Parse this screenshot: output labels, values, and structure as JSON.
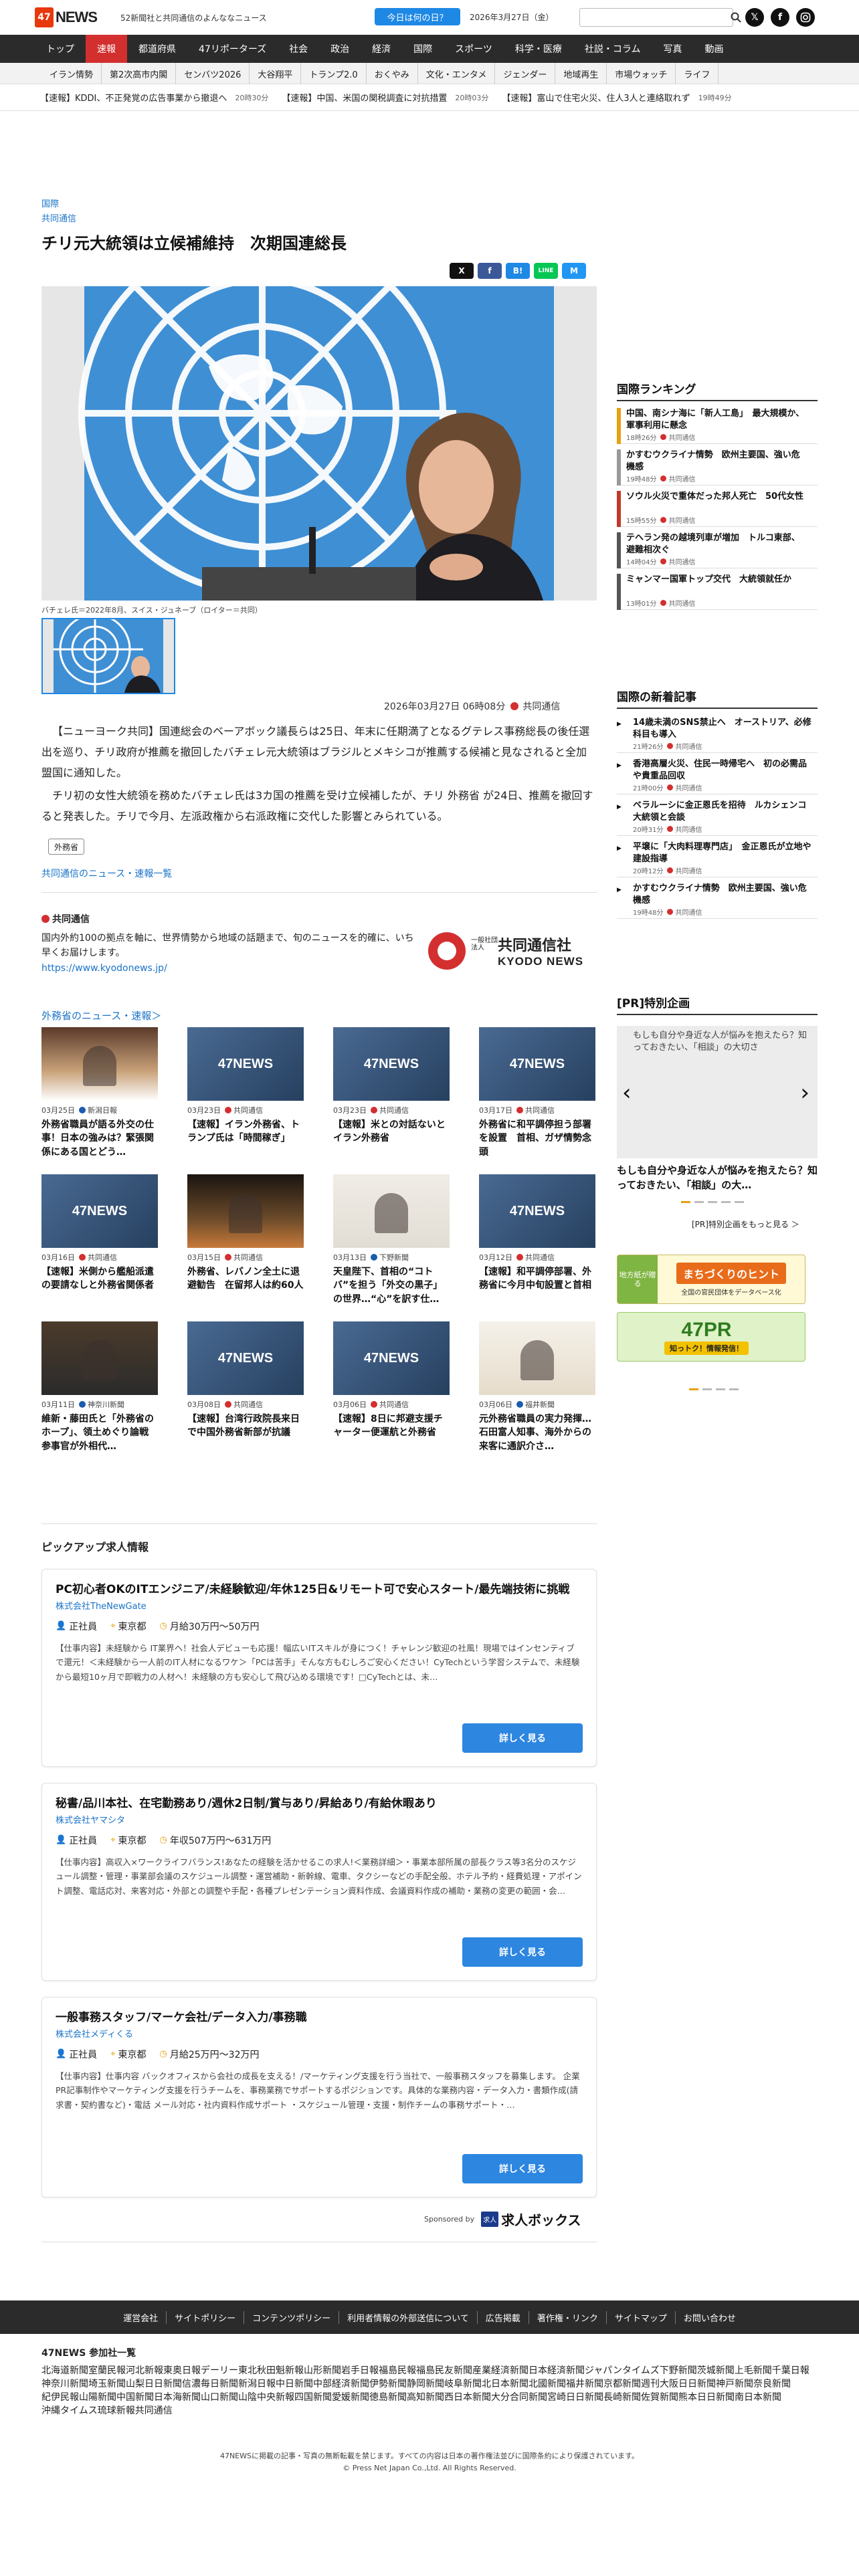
{
  "header": {
    "logo_mark": "47",
    "logo_text": "NEWS",
    "tagline": "52新聞社と共同通信のよんななニュース",
    "today_button": "今日は何の日？",
    "date": "2026年3月27日（金）",
    "search_placeholder": ""
  },
  "main_nav": [
    "トップ",
    "速報",
    "都道府県",
    "47リポーターズ",
    "社会",
    "政治",
    "経済",
    "国際",
    "スポーツ",
    "科学・医療",
    "社説・コラム",
    "写真",
    "動画"
  ],
  "main_nav_active": "速報",
  "sub_nav": [
    "イラン情勢",
    "第2次高市内閣",
    "センバツ2026",
    "大谷翔平",
    "トランプ2.0",
    "おくやみ",
    "文化・エンタメ",
    "ジェンダー",
    "地域再生",
    "市場ウォッチ",
    "ライフ"
  ],
  "ticker": [
    {
      "text": "【速報】KDDI、不正発覚の広告事業から撤退へ",
      "time": "20時30分"
    },
    {
      "text": "【速報】中国、米国の関税調査に対抗措置",
      "time": "20時03分"
    },
    {
      "text": "【速報】富山で住宅火災、住人3人と連絡取れず",
      "time": "19時49分"
    }
  ],
  "article": {
    "category": "国際",
    "source": "共同通信",
    "title": "チリ元大統領は立候補維持　次期国連総長",
    "caption": "バチェレ氏＝2022年8月、スイス・ジュネーブ（ロイター＝共同）",
    "pub_date": "2026年03月27日 06時08分",
    "pub_source": "共同通信",
    "paragraphs": [
      "【ニューヨーク共同】国連総会のベーアボック議長らは25日、年末に任期満了となるグテレス事務総長の後任選出を巡り、チリ政府が推薦を撤回したバチェレ元大統領はブラジルとメキシコが推薦する候補と見なされると全加盟国に通知した。",
      "チリ初の女性大統領を務めたバチェレ氏は3カ国の推薦を受け立候補したが、チリ 外務省 が24日、推薦を撤回すると発表した。チリで今月、左派政権から右派政権に交代した影響とみられている。"
    ],
    "tag": "外務省",
    "more_link": "共同通信のニュース・速報一覧",
    "share": [
      "X",
      "f",
      "B!",
      "LINE",
      "M"
    ]
  },
  "kyodo": {
    "name": "共同通信",
    "desc": "国内外約100の拠点を軸に、世界情勢から地域の話題まで、旬のニュースを的確に、いち早くお届けします。",
    "url": "https://www.kyodonews.jp/",
    "logo_small": "一般社団法人",
    "logo_jp": "共同通信社",
    "logo_en": "KYODO NEWS"
  },
  "related": {
    "heading": "外務省のニュース・速報＞",
    "items": [
      {
        "date": "03月25日",
        "source": "新潟日報",
        "title": "外務省職員が語る外交の仕事！日本の強みは？緊張関係にある国とどう…",
        "img": "photo-room"
      },
      {
        "date": "03月23日",
        "source": "共同通信",
        "title": "【速報】イラン外務省、トランプ氏は「時間稼ぎ」",
        "img": "47news"
      },
      {
        "date": "03月23日",
        "source": "共同通信",
        "title": "【速報】米との対話ないとイラン外務省",
        "img": "47news"
      },
      {
        "date": "03月17日",
        "source": "共同通信",
        "title": "外務省に和平調停担う部署を設置　首相、ガザ情勢念頭",
        "img": "47news"
      },
      {
        "date": "03月16日",
        "source": "共同通信",
        "title": "【速報】米側から艦船派遣の要請なしと外務省関係者",
        "img": "47news"
      },
      {
        "date": "03月15日",
        "source": "共同通信",
        "title": "外務省、レバノン全土に退避勧告　在留邦人は約60人",
        "img": "photo-fire"
      },
      {
        "date": "03月13日",
        "source": "下野新聞",
        "title": "天皇陛下、首相の“コトバ”を担う「外交の黒子」の世界…“心”を訳す仕…",
        "img": "photo-group"
      },
      {
        "date": "03月12日",
        "source": "共同通信",
        "title": "【速報】和平調停部署、外務省に今月中旬設置と首相",
        "img": "47news"
      },
      {
        "date": "03月11日",
        "source": "神奈川新聞",
        "title": "維新・藤田氏と「外務省のホープ」、領土めぐり論戦　参事官が外相代…",
        "img": "photo-man"
      },
      {
        "date": "03月08日",
        "source": "共同通信",
        "title": "【速報】台湾行政院長来日で中国外務省新部が抗議",
        "img": "47news"
      },
      {
        "date": "03月06日",
        "source": "共同通信",
        "title": "【速報】8日に邦避支援チャーター便運航と外務省",
        "img": "47news"
      },
      {
        "date": "03月06日",
        "source": "福井新聞",
        "title": "元外務省職員の実力発揮…石田富人知事、海外からの来客に通訳介さ…",
        "img": "photo-meet"
      }
    ]
  },
  "ranking": {
    "heading": "国際ランキング",
    "items": [
      {
        "rank": "1",
        "title": "中国、南シナ海に「新人工島」　最大規模か、軍事利用に懸念",
        "time": "18時26分",
        "source": "共同通信"
      },
      {
        "rank": "2",
        "title": "かすむウクライナ情勢　欧州主要国、強い危機感",
        "time": "19時48分",
        "source": "共同通信"
      },
      {
        "rank": "3",
        "title": "ソウル火災で重体だった邦人死亡　50代女性",
        "time": "15時55分",
        "source": "共同通信"
      },
      {
        "rank": "4",
        "title": "テヘラン発の越境列車が増加　トルコ東部、避難相次ぐ",
        "time": "14時04分",
        "source": "共同通信"
      },
      {
        "rank": "5",
        "title": "ミャンマー国軍トップ交代　大統領就任か",
        "time": "13時01分",
        "source": "共同通信"
      }
    ]
  },
  "newest": {
    "heading": "国際の新着記事",
    "items": [
      {
        "title": "14歳未満のSNS禁止へ　オーストリア、必修科目も導入",
        "time": "21時26分",
        "source": "共同通信"
      },
      {
        "title": "香港高層火災、住民一時帰宅へ　初の必需品や貴重品回収",
        "time": "21時00分",
        "source": "共同通信"
      },
      {
        "title": "ベラルーシに金正恩氏を招待　ルカシェンコ大統領と会談",
        "time": "20時31分",
        "source": "共同通信"
      },
      {
        "title": "平壌に「大肉料理専門店」　金正恩氏が立地や建設指導",
        "time": "20時12分",
        "source": "共同通信"
      },
      {
        "title": "かすむウクライナ情勢　欧州主要国、強い危機感",
        "time": "19時48分",
        "source": "共同通信"
      }
    ]
  },
  "pr": {
    "heading": "[PR]特別企画",
    "slide_alt": "もしも自分や身近な人が悩みを抱えたら？知っておきたい、「相談」の大切さ",
    "title": "もしも自分や身近な人が悩みを抱えたら？知っておきたい、「相談」の大…",
    "more": "[PR]特別企画をもっと見る ＞",
    "banner1_small": "地方紙が贈る",
    "banner1_big": "まちづくりのヒント",
    "banner1_sub": "全国の官民団体をデータベース化",
    "banner2_big": "47PR",
    "banner2_sub": "知っトク！情報発信！"
  },
  "jobs": {
    "heading": "ピックアップ求人情報",
    "items": [
      {
        "title": "PC初心者OKのITエンジニア/未経験歓迎/年休125日&リモート可で安心スタート/最先端技術に挑戦",
        "company": "株式会社TheNewGate",
        "type": "正社員",
        "place": "東京都",
        "salary": "月給30万円〜50万円",
        "desc": "【仕事内容】未経験から IT業界へ！社会人デビューも応援！幅広いITスキルが身につく！チャレンジ歓迎の社風！現場ではインセンティブで還元！＜未経験から一人前のIT人材になるワケ＞「PCは苦手」そんな方もむしろご安心ください！CyTechという学習システムで、未経験から最短10ヶ月で即戦力の人材へ！未経験の方も安心して飛び込める環境です！□CyTechとは、未…",
        "button": "詳しく見る"
      },
      {
        "title": "秘書/品川本社、在宅勤務あり/週休2日制/賞与あり/昇給あり/有給休暇あり",
        "company": "株式会社ヤマシタ",
        "type": "正社員",
        "place": "東京都",
        "salary": "年収507万円〜631万円",
        "desc": "【仕事内容】高収入×ワークライフバランス!あなたの経験を活かせるこの求人!＜業務詳細＞・事業本部所属の部長クラス等3名分のスケジュール調整・管理・事業部会議のスケジュール調整・運営補助・新幹線、電車、タクシーなどの手配全般、ホテル予約・経費処理・アポイント調整、電話応対、来客対応・外部との調整や手配・各種プレゼンテーション資料作成、会議資料作成の補助・業務の変更の範囲・会…",
        "button": "詳しく見る"
      },
      {
        "title": "一般事務スタッフ/マーケ会社/データ入力/事務職",
        "company": "株式会社メディくる",
        "type": "正社員",
        "place": "東京都",
        "salary": "月給25万円〜32万円",
        "desc": "【仕事内容】仕事内容 バックオフィスから会社の成長を支える！/マーケティング支援を行う当社で、一般事務スタッフを募集します。 企業PR記事制作やマーケティング支援を行うチームを、事務業務でサポートするポジションです。具体的な業務内容・データ入力・書類作成(請求書・契約書など)・電話 メール対応・社内資料作成サポート ・スケジュール管理・支援・制作チームの事務サポート・…",
        "button": "詳しく見る"
      }
    ],
    "sponsored_by": "Sponsored by",
    "sponsor_mark": "求人",
    "sponsor_name": "求人ボックス"
  },
  "footer": {
    "links": [
      "運営会社",
      "サイトポリシー",
      "コンテンツポリシー",
      "利用者情報の外部送信について",
      "広告掲載",
      "著作権・リンク",
      "サイトマップ",
      "お問い合わせ"
    ],
    "members_heading": "47NEWS 参加社一覧",
    "members": [
      "北海道新聞",
      "室蘭民報",
      "河北新報",
      "東奥日報",
      "デーリー東北",
      "秋田魁新報",
      "山形新聞",
      "岩手日報",
      "福島民報",
      "福島民友新聞",
      "産業経済新聞",
      "日本経済新聞",
      "ジャパンタイムズ",
      "下野新聞",
      "茨城新聞",
      "上毛新聞",
      "千葉日報",
      "神奈川新聞",
      "埼玉新聞",
      "山梨日日新聞",
      "信濃毎日新聞",
      "新潟日報",
      "中日新聞",
      "中部経済新聞",
      "伊勢新聞",
      "静岡新聞",
      "岐阜新聞",
      "北日本新聞",
      "北國新聞",
      "福井新聞",
      "京都新聞",
      "週刊大阪日日新聞",
      "神戸新聞",
      "奈良新聞",
      "紀伊民報",
      "山陽新聞",
      "中国新聞",
      "日本海新聞",
      "山口新聞",
      "山陰中央新報",
      "四国新聞",
      "愛媛新聞",
      "徳島新聞",
      "高知新聞",
      "西日本新聞",
      "大分合同新聞",
      "宮崎日日新聞",
      "長崎新聞",
      "佐賀新聞",
      "熊本日日新聞",
      "南日本新聞",
      "沖縄タイムス",
      "琉球新報",
      "共同通信"
    ],
    "copy1": "47NEWSに掲載の記事・写真の無断転載を禁じます。すべての内容は日本の著作権法並びに国際条約により保護されています。",
    "copy2": "© Press Net Japan Co.,Ltd. All Rights Reserved."
  },
  "colors": {
    "brand": "#e8380d",
    "accent": "#1a73c8",
    "nav_bg": "#2b2b2b",
    "nav_active": "#d32f2f",
    "button": "#2d86e0"
  }
}
